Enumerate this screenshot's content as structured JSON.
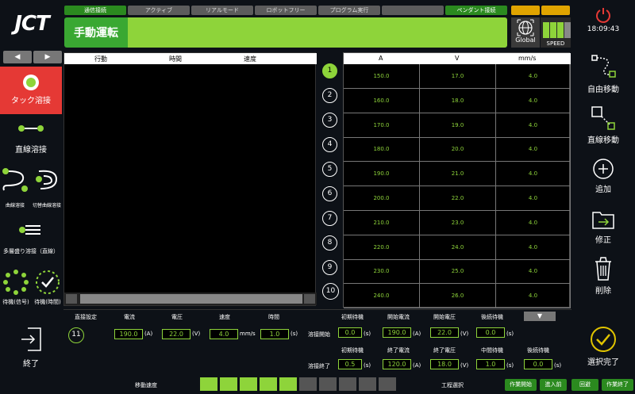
{
  "brand": "JCT",
  "status_tabs": [
    "通信接続",
    "アクティブ",
    "リアルモード",
    "ロボットフリー",
    "プログラム実行",
    "",
    "ペンダント接続"
  ],
  "mode_title": "手動運転",
  "global_label": "Global",
  "speed_label": "SPEED",
  "time": "18:09:43",
  "right_menu": [
    "自由移動",
    "直線移動",
    "追加",
    "修正",
    "削除",
    "選択完了"
  ],
  "left_menu": {
    "tack": "タック溶接",
    "line": "直線溶接",
    "curve": "曲線溶接",
    "switch_curve": "切替曲線溶接",
    "multi": "多層盛り溶接（直線）",
    "wait_signal": "待機(信号)",
    "wait_time": "待機(時間)",
    "end": "終了"
  },
  "left_table": {
    "headers": [
      "行動",
      "時間",
      "速度"
    ]
  },
  "numbers": [
    "1",
    "2",
    "3",
    "4",
    "5",
    "6",
    "7",
    "8",
    "9",
    "10"
  ],
  "right_table": {
    "headers": [
      "A",
      "V",
      "mm/s"
    ],
    "rows": [
      [
        "150.0",
        "17.0",
        "4.0"
      ],
      [
        "160.0",
        "18.0",
        "4.0"
      ],
      [
        "170.0",
        "19.0",
        "4.0"
      ],
      [
        "180.0",
        "20.0",
        "4.0"
      ],
      [
        "190.0",
        "21.0",
        "4.0"
      ],
      [
        "200.0",
        "22.0",
        "4.0"
      ],
      [
        "210.0",
        "23.0",
        "4.0"
      ],
      [
        "220.0",
        "24.0",
        "4.0"
      ],
      [
        "230.0",
        "25.0",
        "4.0"
      ],
      [
        "240.0",
        "26.0",
        "4.0"
      ]
    ]
  },
  "settings": {
    "index": "11",
    "direct_label": "直接設定",
    "col_current": "電流",
    "col_voltage": "電圧",
    "col_speed": "速度",
    "col_time": "時間",
    "current": "190.0",
    "voltage": "22.0",
    "speed": "4.0",
    "time": "1.0",
    "unit_a": "(A)",
    "unit_v": "(V)",
    "unit_mms": "mm/s",
    "unit_s": "(s)",
    "start_label": "溶接開始",
    "end_label": "溶接終了",
    "start_h1": "初期待機",
    "start_h2": "開始電流",
    "start_h3": "開始電圧",
    "start_h4": "後続待機",
    "start_wait": "0.0",
    "start_current": "190.0",
    "start_voltage": "22.0",
    "start_after": "0.0",
    "end_h1": "初期待機",
    "end_h2": "終了電流",
    "end_h3": "終了電圧",
    "end_h4": "中間待機",
    "end_h5": "後続待機",
    "end_wait": "0.5",
    "end_current": "120.0",
    "end_voltage": "18.0",
    "end_mid": "1.0",
    "end_after": "0.0"
  },
  "bottom": {
    "move_speed": "移動速度",
    "process_select": "工程選択",
    "btn_start": "作業開始",
    "btn_approach": "進入前",
    "btn_return": "回避",
    "btn_finish": "作業終了"
  },
  "colors": {
    "accent": "#8ed43a",
    "dark_green": "#2b8a1f",
    "alert": "#e53935"
  }
}
